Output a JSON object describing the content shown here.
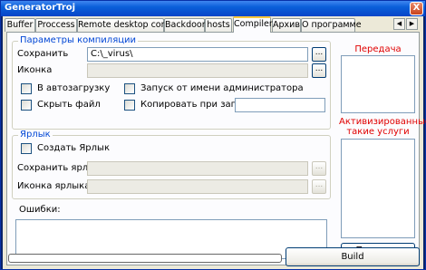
{
  "window": {
    "title": "GeneratorTroj",
    "close": "X"
  },
  "tabs": [
    {
      "label": "Buffer"
    },
    {
      "label": "Proccess"
    },
    {
      "label": "Remote desktop control"
    },
    {
      "label": "Backdoor"
    },
    {
      "label": "hosts"
    },
    {
      "label": "Compiler"
    },
    {
      "label": "Архив"
    },
    {
      "label": "О программе"
    }
  ],
  "active_tab": "Compiler",
  "compile_group": {
    "legend": "Параметры компиляции",
    "save_label": "Сохранить",
    "save_value": "C:\\_virus\\",
    "icon_label": "Иконка",
    "icon_value": "",
    "browse": "...",
    "autorun_label": "В автозагрузку",
    "hide_label": "Скрыть файл",
    "admin_label": "Запуск от имени администратора",
    "copy_label": "Копировать при запуске",
    "copy_value": ""
  },
  "shortcut_group": {
    "legend": "Ярлык",
    "create_label": "Создать Ярлык",
    "save_label": "Сохранить ярлык",
    "icon_label": "Иконка ярлыка",
    "browse": "..."
  },
  "errors_label": "Ошибки:",
  "data_transfer_label": "Передача данных",
  "activated_services_label": "Активизированные такие услуги",
  "show_button": "Показать",
  "build_button": "Build"
}
